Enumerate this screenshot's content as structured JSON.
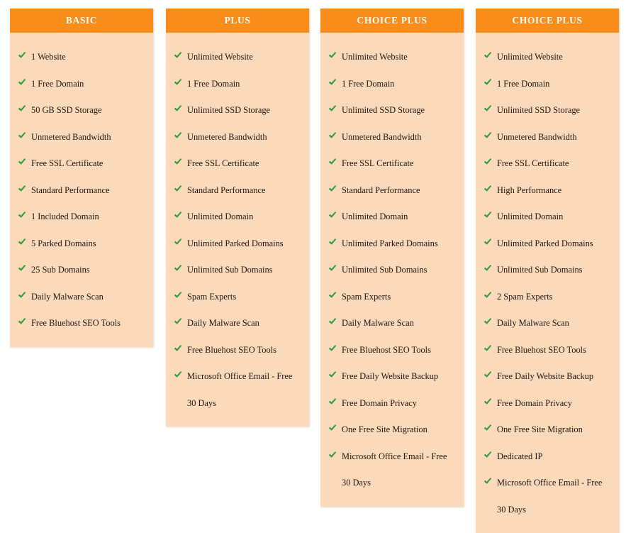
{
  "page": {
    "title": "Hosting Plan Comparison",
    "check_icon": "check-icon",
    "colors": {
      "header_background": "#fa8c19",
      "header_text": "#fffaf0",
      "body_background": "#fbd9bb",
      "feature_text": "#20160d",
      "check_mark": "#2e9b3c",
      "page_background": "#ffffff"
    }
  },
  "columns": [
    {
      "id": "basic",
      "header": "BASIC",
      "features": [
        "1 Website",
        "1 Free Domain",
        "50 GB SSD Storage",
        "Unmetered Bandwidth",
        "Free SSL Certificate",
        "Standard Performance",
        "1 Included Domain",
        "5 Parked Domains",
        "25 Sub Domains",
        "Daily Malware Scan",
        "Free Bluehost SEO Tools"
      ]
    },
    {
      "id": "plus",
      "header": "PLUS",
      "features": [
        "Unlimited Website",
        "1 Free Domain",
        "Unlimited SSD Storage",
        "Unmetered Bandwidth",
        "Free SSL Certificate",
        "Standard Performance",
        "Unlimited Domain",
        "Unlimited Parked Domains",
        "Unlimited Sub Domains",
        "Spam Experts",
        "Daily Malware Scan",
        "Free Bluehost SEO Tools",
        "Microsoft Office Email - Free 30 Days"
      ]
    },
    {
      "id": "choice-plus-1",
      "header": "CHOICE PLUS",
      "features": [
        "Unlimited Website",
        "1 Free Domain",
        "Unlimited SSD Storage",
        "Unmetered Bandwidth",
        "Free SSL Certificate",
        "Standard Performance",
        "Unlimited Domain",
        "Unlimited Parked Domains",
        "Unlimited Sub Domains",
        "Spam Experts",
        "Daily Malware Scan",
        "Free Bluehost SEO Tools",
        "Free Daily Website Backup",
        "Free Domain Privacy",
        "One Free Site Migration",
        "Microsoft Office Email - Free 30 Days"
      ]
    },
    {
      "id": "choice-plus-2",
      "header": "CHOICE PLUS",
      "features": [
        "Unlimited Website",
        "1 Free Domain",
        "Unlimited SSD Storage",
        "Unmetered Bandwidth",
        "Free SSL Certificate",
        "High Performance",
        "Unlimited Domain",
        "Unlimited Parked Domains",
        "Unlimited Sub Domains",
        "2 Spam Experts",
        "Daily Malware Scan",
        "Free Bluehost SEO Tools",
        "Free Daily Website Backup",
        "Free Domain Privacy",
        "One Free Site Migration",
        "Dedicated IP",
        "Microsoft Office Email - Free 30 Days"
      ]
    }
  ]
}
